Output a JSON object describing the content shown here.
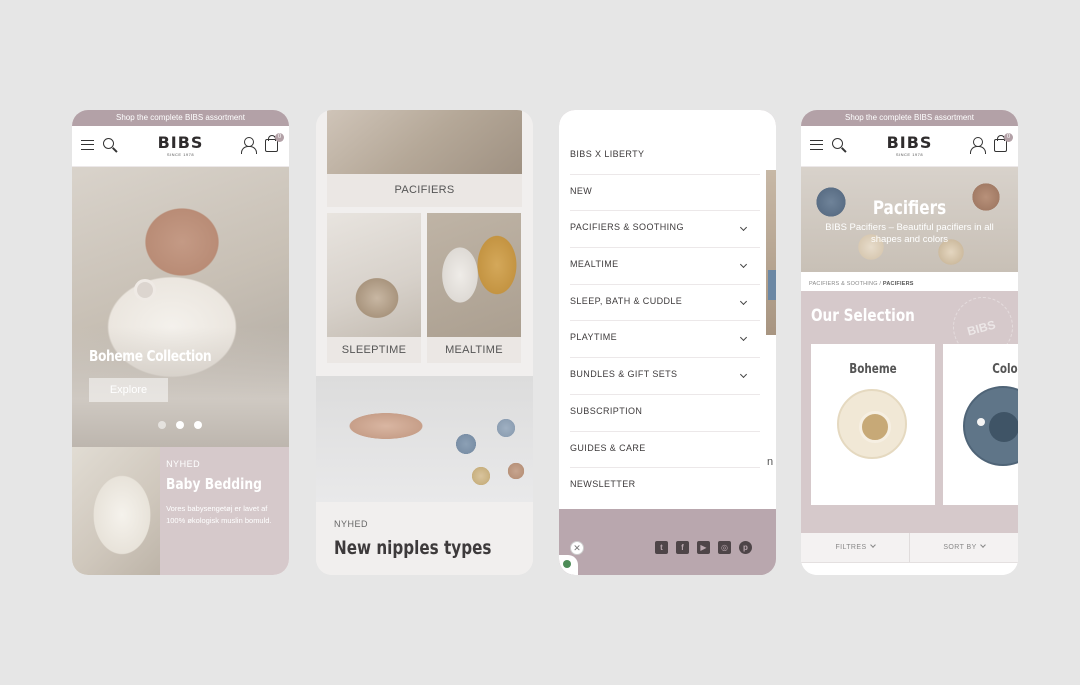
{
  "announcement": "Shop the complete BIBS assortment",
  "logo": {
    "word": "BIBS",
    "since": "SINCE 1978"
  },
  "cart_count": "0",
  "screen1": {
    "hero_title": "Boheme Collection",
    "hero_button": "Explore",
    "promo": {
      "tag": "NYHED",
      "title": "Baby Bedding",
      "description": "Vores babysengetøj er lavet af 100% økologisk muslin bomuld."
    }
  },
  "screen2": {
    "categories": {
      "pacifiers": "PACIFIERS",
      "sleeptime": "SLEEPTIME",
      "mealtime": "MEALTIME"
    },
    "news": {
      "tag": "NYHED",
      "title": "New nipples types"
    }
  },
  "screen3": {
    "menu": [
      {
        "label": "BIBS X LIBERTY",
        "has_children": false
      },
      {
        "label": "NEW",
        "has_children": false
      },
      {
        "label": "PACIFIERS & SOOTHING",
        "has_children": true
      },
      {
        "label": "MEALTIME",
        "has_children": true
      },
      {
        "label": "SLEEP, BATH & CUDDLE",
        "has_children": true
      },
      {
        "label": "PLAYTIME",
        "has_children": true
      },
      {
        "label": "BUNDLES & GIFT SETS",
        "has_children": true
      },
      {
        "label": "SUBSCRIPTION",
        "has_children": false
      },
      {
        "label": "GUIDES & CARE",
        "has_children": false
      },
      {
        "label": "NEWSLETTER",
        "has_children": false
      }
    ],
    "behind_text": "n",
    "socials": [
      "twitter-icon",
      "facebook-icon",
      "youtube-icon",
      "instagram-icon",
      "pinterest-icon"
    ]
  },
  "screen4": {
    "hero_title": "Pacifiers",
    "hero_subtitle": "BIBS Pacifiers – Beautiful pacifiers in all shapes and colors",
    "breadcrumb": {
      "parent": "PACIFIERS & SOOTHING",
      "separator": " / ",
      "current": "PACIFIERS"
    },
    "selection_title": "Our Selection",
    "stamp_text": "BIBS",
    "cards": [
      {
        "title": "Boheme"
      },
      {
        "title": "Colour"
      }
    ],
    "filters_label": "FILTRES",
    "sort_label": "SORT BY"
  },
  "colors": {
    "brand_mauve": "#b3a1a7",
    "panel_pink": "#d6c9cb",
    "background": "#e6e6e6"
  }
}
